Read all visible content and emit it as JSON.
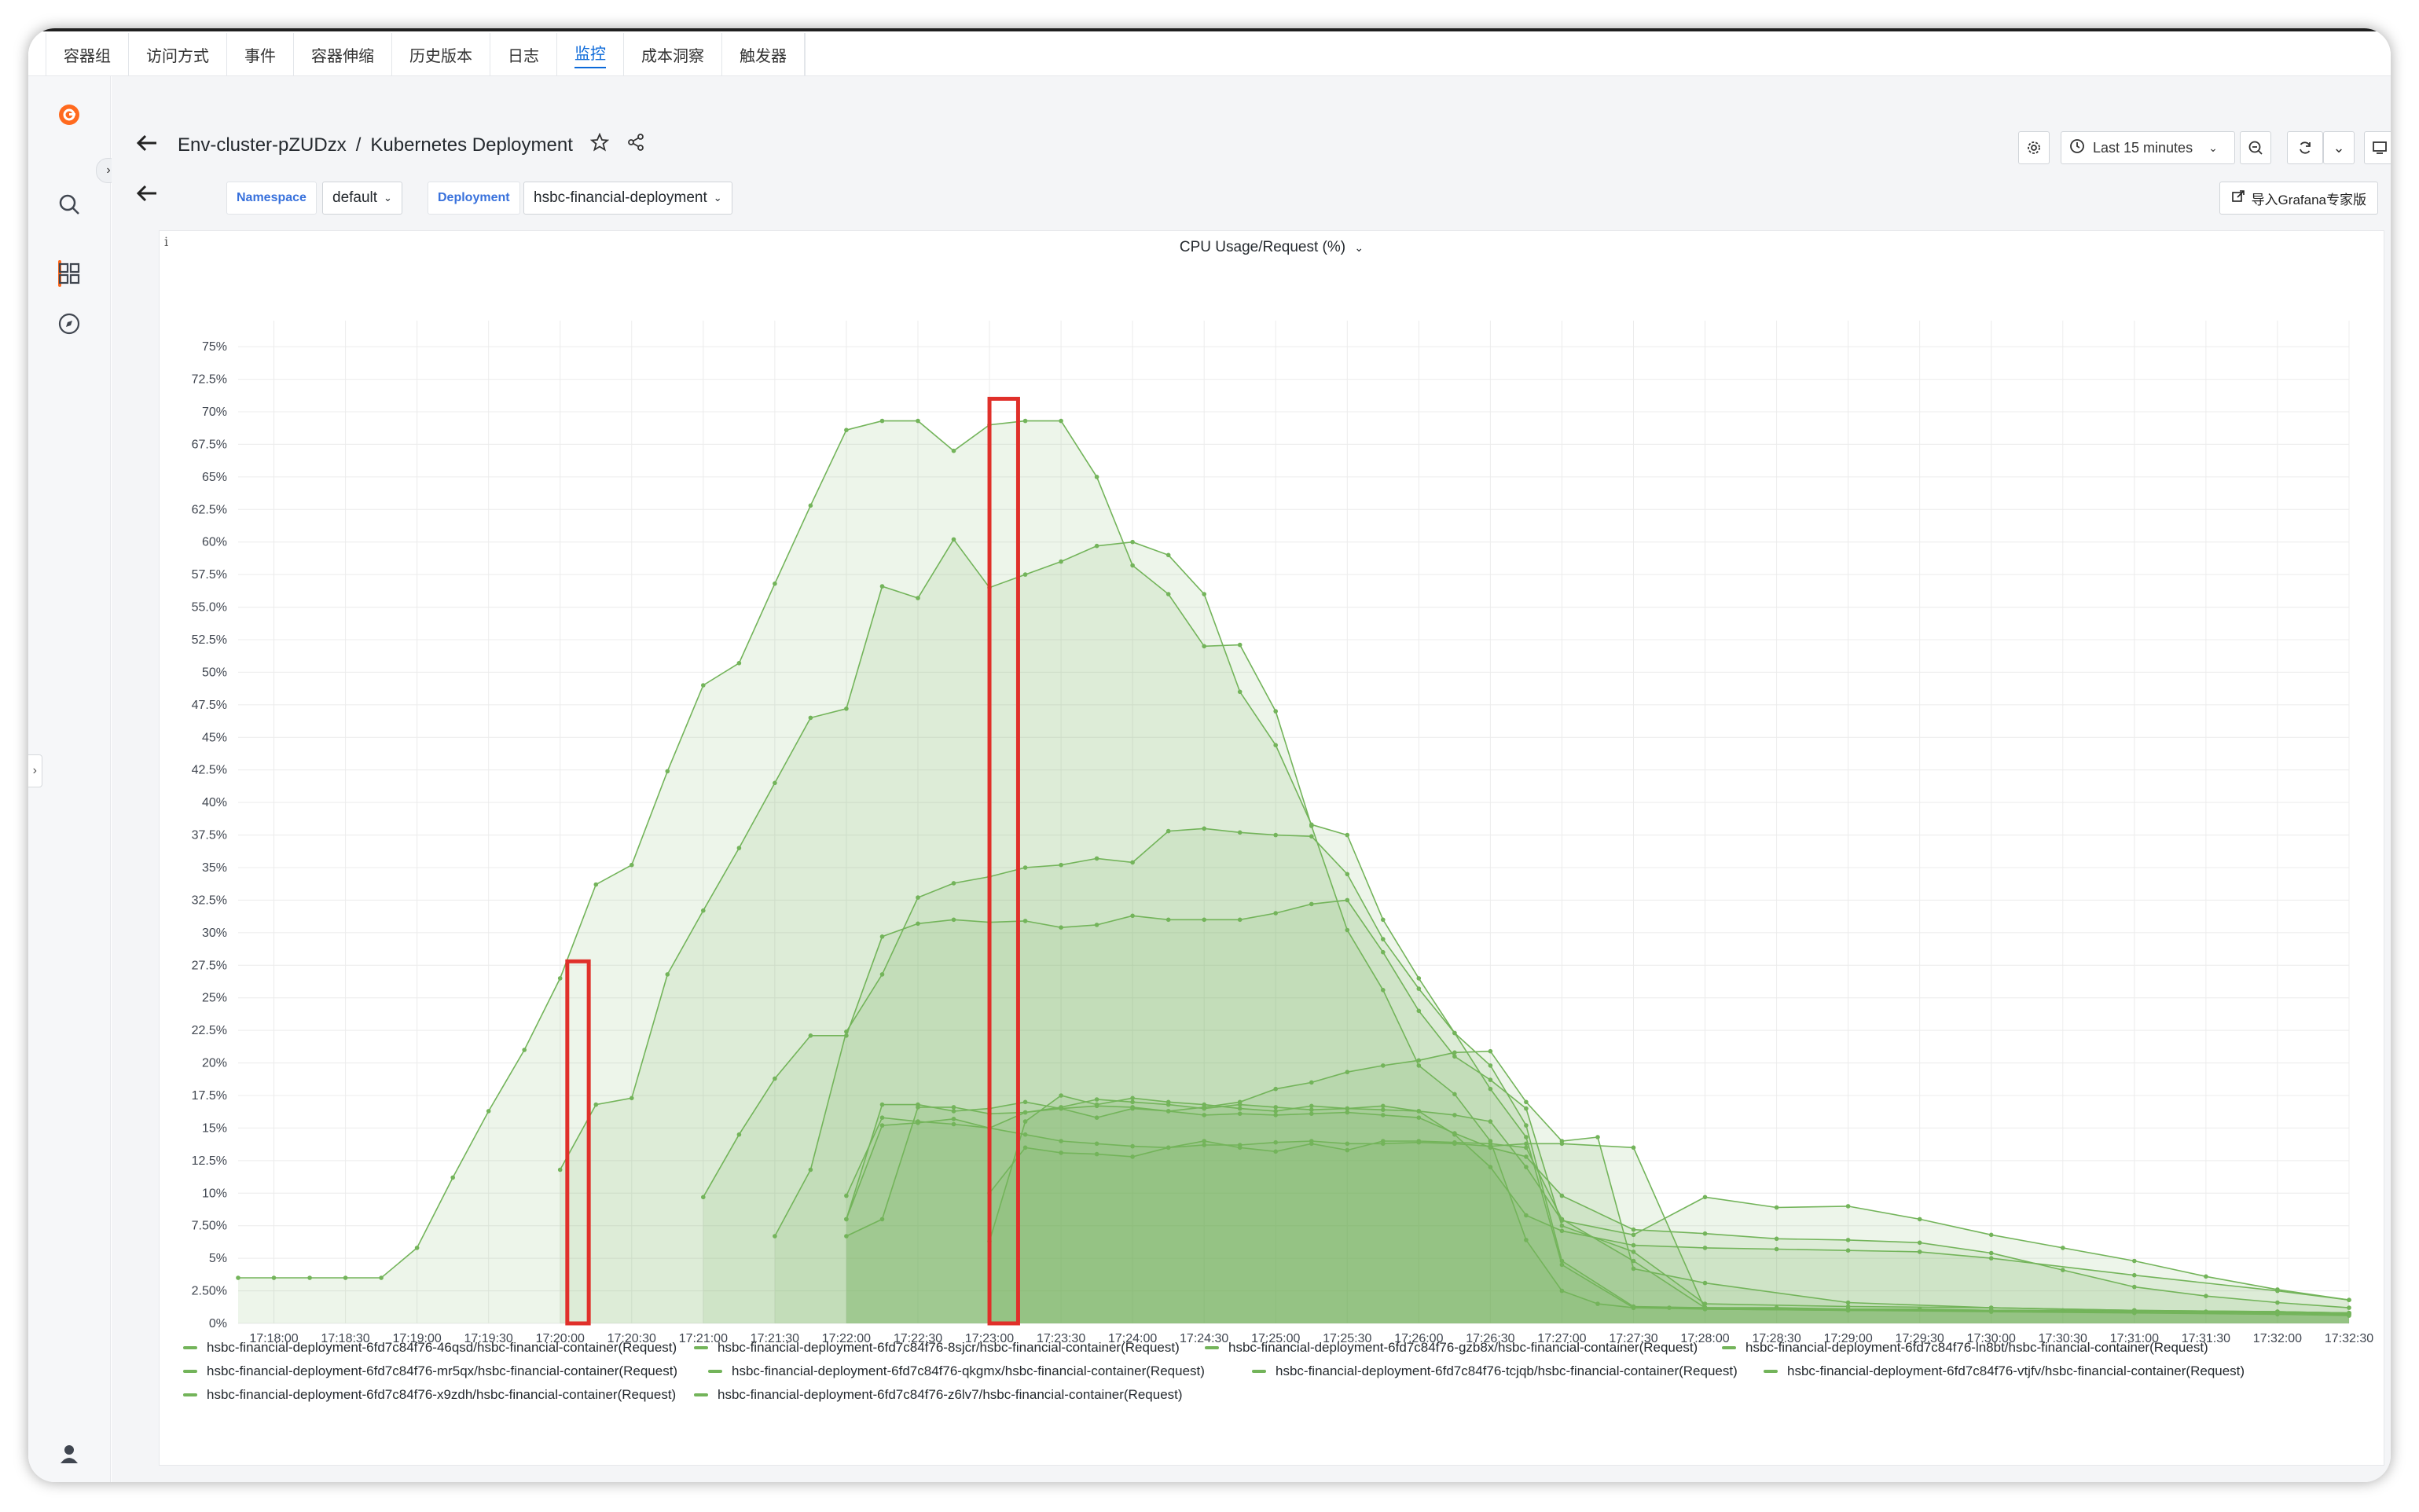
{
  "tabs": [
    {
      "label": "容器组",
      "active": false
    },
    {
      "label": "访问方式",
      "active": false
    },
    {
      "label": "事件",
      "active": false
    },
    {
      "label": "容器伸缩",
      "active": false
    },
    {
      "label": "历史版本",
      "active": false
    },
    {
      "label": "日志",
      "active": false
    },
    {
      "label": "监控",
      "active": true
    },
    {
      "label": "成本洞察",
      "active": false
    },
    {
      "label": "触发器",
      "active": false
    }
  ],
  "breadcrumb": {
    "folder": "Env-cluster-pZUDzx",
    "separator": "/",
    "dashboard": "Kubernetes Deployment"
  },
  "variables": {
    "namespace_label": "Namespace",
    "namespace_value": "default",
    "deployment_label": "Deployment",
    "deployment_value": "hsbc-financial-deployment"
  },
  "toolbar": {
    "time_range": "Last 15 minutes",
    "import_label": "导入Grafana专家版"
  },
  "panel": {
    "title": "CPU Usage/Request (%)",
    "info": "i"
  },
  "colors": {
    "series": "#73b45a",
    "highlight": "#e0302a",
    "accent_tab": "#0b69d9",
    "logo": "#ff6a1f"
  },
  "chart_data": {
    "type": "area",
    "ylim": [
      0,
      77
    ],
    "y_ticks": [
      "0%",
      "2.50%",
      "5%",
      "7.50%",
      "10%",
      "12.5%",
      "15%",
      "17.5%",
      "20%",
      "22.5%",
      "25%",
      "27.5%",
      "30%",
      "32.5%",
      "35%",
      "37.5%",
      "40%",
      "42.5%",
      "45%",
      "47.5%",
      "50%",
      "52.5%",
      "55.0%",
      "57.5%",
      "60%",
      "62.5%",
      "65%",
      "67.5%",
      "70%",
      "72.5%",
      "75%"
    ],
    "x_ticks": [
      "17:18:00",
      "17:18:30",
      "17:19:00",
      "17:19:30",
      "17:20:00",
      "17:20:30",
      "17:21:00",
      "17:21:30",
      "17:22:00",
      "17:22:30",
      "17:23:00",
      "17:23:30",
      "17:24:00",
      "17:24:30",
      "17:25:00",
      "17:25:30",
      "17:26:00",
      "17:26:30",
      "17:27:00",
      "17:27:30",
      "17:28:00",
      "17:28:30",
      "17:29:00",
      "17:29:30",
      "17:30:00",
      "17:30:30",
      "17:31:00",
      "17:31:30",
      "17:32:00",
      "17:32:30"
    ],
    "x_range": [
      "17:17:45",
      "17:32:30"
    ],
    "series": [
      {
        "name": "hsbc-financial-deployment-6fd7c84f76-46qsd/hsbc-financial-container(Request)",
        "x": [
          "17:17:45",
          "17:18:00",
          "17:18:15",
          "17:18:30",
          "17:18:45",
          "17:19:00",
          "17:19:15",
          "17:19:30",
          "17:19:45",
          "17:20:00",
          "17:20:15",
          "17:20:30",
          "17:20:45",
          "17:21:00",
          "17:21:15",
          "17:21:30",
          "17:21:45",
          "17:22:00",
          "17:22:15",
          "17:22:30",
          "17:22:45",
          "17:23:00",
          "17:23:15",
          "17:23:30",
          "17:23:45",
          "17:24:00",
          "17:24:15",
          "17:24:30",
          "17:24:45",
          "17:25:00",
          "17:25:15",
          "17:25:30",
          "17:25:45",
          "17:26:00",
          "17:26:15",
          "17:26:30",
          "17:26:45",
          "17:27:00",
          "17:27:15",
          "17:27:30",
          "17:27:45",
          "17:28:00",
          "17:28:30",
          "17:29:00",
          "17:29:30",
          "17:30:00",
          "17:30:30",
          "17:31:00",
          "17:31:30",
          "17:32:00",
          "17:32:30"
        ],
        "values": [
          3.5,
          3.5,
          3.5,
          3.5,
          3.5,
          5.8,
          11.2,
          16.3,
          21,
          26.5,
          33.7,
          35.2,
          42.4,
          49,
          50.7,
          56.8,
          62.8,
          68.6,
          69.3,
          69.3,
          67,
          69,
          69.3,
          69.3,
          65,
          58.2,
          56,
          52,
          52.1,
          47,
          38.2,
          30.2,
          25.6,
          19.8,
          17.6,
          14,
          6.4,
          2.5,
          1.5,
          1.2,
          1.2,
          1.2,
          1.2,
          1.1,
          1.1,
          1.0,
          1.0,
          1.0,
          0.9,
          0.9,
          0.8
        ]
      },
      {
        "name": "hsbc-financial-deployment-6fd7c84f76-8sjcr/hsbc-financial-container(Request)",
        "x": [
          "17:20:00",
          "17:20:15",
          "17:20:30",
          "17:20:45",
          "17:21:00",
          "17:21:15",
          "17:21:30",
          "17:21:45",
          "17:22:00",
          "17:22:15",
          "17:22:30",
          "17:22:45",
          "17:23:00",
          "17:23:15",
          "17:23:30",
          "17:23:45",
          "17:24:00",
          "17:24:15",
          "17:24:30",
          "17:24:45",
          "17:25:00",
          "17:25:15",
          "17:25:30",
          "17:25:45",
          "17:26:00",
          "17:26:15",
          "17:26:30",
          "17:26:45",
          "17:27:00",
          "17:27:30",
          "17:28:00",
          "17:29:00",
          "17:30:00",
          "17:31:00",
          "17:32:00",
          "17:32:30"
        ],
        "values": [
          11.8,
          16.8,
          17.3,
          26.8,
          31.7,
          36.5,
          41.5,
          46.5,
          47.2,
          56.6,
          55.7,
          60.2,
          56.5,
          57.5,
          58.5,
          59.7,
          60,
          59,
          56,
          48.5,
          44.4,
          38.3,
          37.5,
          31,
          26.5,
          22.3,
          19.8,
          15.2,
          4.8,
          1.3,
          1.2,
          1.1,
          1.0,
          0.9,
          0.8,
          0.7
        ]
      },
      {
        "name": "hsbc-financial-deployment-6fd7c84f76-gzb8x/hsbc-financial-container(Request)",
        "x": [
          "17:21:00",
          "17:21:15",
          "17:21:30",
          "17:21:45",
          "17:22:00",
          "17:22:15",
          "17:22:30",
          "17:22:45",
          "17:23:00",
          "17:23:15",
          "17:23:30",
          "17:23:45",
          "17:24:00",
          "17:24:15",
          "17:24:30",
          "17:24:45",
          "17:25:00",
          "17:25:15",
          "17:25:30",
          "17:25:45",
          "17:26:00",
          "17:26:15",
          "17:26:30",
          "17:26:45",
          "17:27:00",
          "17:27:30",
          "17:28:00",
          "17:29:00",
          "17:30:00",
          "17:31:00",
          "17:32:00",
          "17:32:30"
        ],
        "values": [
          9.7,
          14.5,
          18.8,
          22.1,
          22.1,
          29.7,
          30.7,
          31,
          30.8,
          30.9,
          30.4,
          30.6,
          31.3,
          31,
          31,
          31,
          31.5,
          32.2,
          32.5,
          28.5,
          24,
          20.5,
          18.7,
          16.5,
          7.5,
          5.5,
          1.5,
          1.3,
          1.2,
          1.0,
          0.9,
          0.8
        ]
      },
      {
        "name": "hsbc-financial-deployment-6fd7c84f76-ln8bt/hsbc-financial-container(Request)",
        "x": [
          "17:22:00",
          "17:22:15",
          "17:22:30",
          "17:22:45",
          "17:23:00",
          "17:23:15",
          "17:23:30",
          "17:23:45",
          "17:24:00",
          "17:24:15",
          "17:24:30",
          "17:24:45",
          "17:25:00",
          "17:25:15",
          "17:25:30",
          "17:25:45",
          "17:26:00",
          "17:26:15",
          "17:26:30",
          "17:26:45",
          "17:27:00",
          "17:27:30",
          "17:28:00",
          "17:28:30",
          "17:29:00",
          "17:29:30",
          "17:30:00",
          "17:30:30",
          "17:31:00",
          "17:31:30",
          "17:32:00",
          "17:32:30"
        ],
        "values": [
          6.7,
          8.0,
          16.6,
          16.6,
          16.1,
          16.2,
          16.5,
          16.7,
          16.6,
          16.3,
          16.0,
          16.1,
          16.0,
          16.1,
          16.2,
          16.0,
          15.8,
          14.6,
          13.5,
          12.8,
          9.8,
          7.2,
          6.9,
          6.5,
          6.4,
          6.2,
          5.4,
          4.1,
          2.8,
          2.1,
          1.6,
          1.2
        ]
      },
      {
        "name": "hsbc-financial-deployment-6fd7c84f76-mr5qx/hsbc-financial-container(Request)",
        "x": [
          "17:22:00",
          "17:22:15",
          "17:22:30",
          "17:22:45",
          "17:23:00",
          "17:23:15",
          "17:23:30",
          "17:23:45",
          "17:24:00",
          "17:24:15",
          "17:24:30",
          "17:24:45",
          "17:25:00",
          "17:25:15",
          "17:25:30",
          "17:25:45",
          "17:26:00",
          "17:26:15",
          "17:26:30",
          "17:26:45",
          "17:27:00",
          "17:27:30",
          "17:28:00",
          "17:29:00",
          "17:30:00",
          "17:31:00",
          "17:32:00",
          "17:32:30"
        ],
        "values": [
          9.8,
          15.8,
          15.5,
          15.3,
          15.0,
          14.5,
          14.0,
          13.8,
          13.6,
          13.5,
          13.7,
          13.7,
          13.9,
          14.0,
          13.8,
          13.8,
          13.9,
          13.8,
          13.6,
          13.8,
          13.8,
          13.5,
          1.1,
          1.0,
          1.0,
          0.9,
          0.8,
          0.7
        ]
      },
      {
        "name": "hsbc-financial-deployment-6fd7c84f76-qkgmx/hsbc-financial-container(Request)",
        "x": [
          "17:23:00",
          "17:23:15",
          "17:23:30",
          "17:23:45",
          "17:24:00",
          "17:24:15",
          "17:24:30",
          "17:24:45",
          "17:25:00",
          "17:25:15",
          "17:25:30",
          "17:25:45",
          "17:26:00",
          "17:26:15",
          "17:26:30",
          "17:26:45",
          "17:27:00",
          "17:27:30",
          "17:28:00",
          "17:28:30",
          "17:29:00",
          "17:29:30",
          "17:30:00",
          "17:30:30",
          "17:31:00",
          "17:31:30",
          "17:32:00",
          "17:32:30"
        ],
        "values": [
          6.3,
          15.5,
          17.5,
          16.8,
          17.3,
          17.0,
          16.8,
          16.5,
          16.3,
          16.7,
          16.5,
          16.4,
          16.3,
          16.0,
          15.5,
          12.0,
          7.9,
          6.8,
          9.7,
          8.9,
          9.0,
          8.0,
          6.8,
          5.8,
          4.8,
          3.6,
          2.6,
          1.8
        ]
      },
      {
        "name": "hsbc-financial-deployment-6fd7c84f76-tcjqb/hsbc-financial-container(Request)",
        "x": [
          "17:21:30",
          "17:21:45",
          "17:22:00",
          "17:22:15",
          "17:22:30",
          "17:22:45",
          "17:23:00",
          "17:23:15",
          "17:23:30",
          "17:23:45",
          "17:24:00",
          "17:24:15",
          "17:24:30",
          "17:24:45",
          "17:25:00",
          "17:25:15",
          "17:25:30",
          "17:25:45",
          "17:26:00",
          "17:26:15",
          "17:26:30",
          "17:26:45",
          "17:27:00",
          "17:27:30",
          "17:28:00",
          "17:29:00",
          "17:30:00",
          "17:31:00",
          "17:32:00",
          "17:32:30"
        ],
        "values": [
          6.7,
          11.8,
          22.4,
          26.8,
          32.7,
          33.8,
          34.3,
          35.0,
          35.2,
          35.7,
          35.4,
          37.8,
          38.0,
          37.7,
          37.5,
          37.4,
          34.5,
          29.5,
          25.7,
          22.3,
          18.0,
          14.3,
          4.5,
          1.2,
          1.1,
          1.0,
          0.9,
          0.8,
          0.7,
          0.6
        ]
      },
      {
        "name": "hsbc-financial-deployment-6fd7c84f76-vtjfv/hsbc-financial-container(Request)",
        "x": [
          "17:22:00",
          "17:22:15",
          "17:22:30",
          "17:22:45",
          "17:23:00",
          "17:23:15",
          "17:23:30",
          "17:23:45",
          "17:24:00",
          "17:24:15",
          "17:24:30",
          "17:24:45",
          "17:25:00",
          "17:25:15",
          "17:25:30",
          "17:25:45",
          "17:26:00",
          "17:26:15",
          "17:26:30",
          "17:26:45",
          "17:27:00",
          "17:27:15",
          "17:27:30",
          "17:28:00",
          "17:29:00",
          "17:30:00",
          "17:31:00",
          "17:32:00",
          "17:32:30"
        ],
        "values": [
          8.0,
          16.8,
          16.8,
          16.3,
          16.5,
          17.0,
          16.5,
          15.8,
          16.5,
          16.3,
          16.6,
          17.0,
          18.0,
          18.5,
          19.3,
          19.8,
          20.2,
          20.8,
          20.9,
          17.0,
          14.0,
          14.3,
          4.2,
          3.1,
          1.6,
          1.2,
          1.0,
          0.9,
          0.8
        ]
      },
      {
        "name": "hsbc-financial-deployment-6fd7c84f76-x9zdh/hsbc-financial-container(Request)",
        "x": [
          "17:23:00",
          "17:23:15",
          "17:23:30",
          "17:23:45",
          "17:24:00",
          "17:24:15",
          "17:24:30",
          "17:24:45",
          "17:25:00",
          "17:25:15",
          "17:25:30",
          "17:25:45",
          "17:26:00",
          "17:26:15",
          "17:26:30",
          "17:26:45",
          "17:27:00",
          "17:27:30",
          "17:28:00",
          "17:29:00",
          "17:30:00",
          "17:31:00",
          "17:32:00",
          "17:32:30"
        ],
        "values": [
          10.0,
          13.5,
          13.1,
          13.0,
          12.8,
          13.5,
          14.0,
          13.5,
          13.2,
          13.8,
          13.3,
          14.0,
          14.0,
          13.9,
          13.8,
          13.5,
          8.0,
          4.8,
          1.2,
          1.1,
          1.0,
          0.9,
          0.8,
          0.7
        ]
      },
      {
        "name": "hsbc-financial-deployment-6fd7c84f76-z6lv7/hsbc-financial-container(Request)",
        "x": [
          "17:22:00",
          "17:22:15",
          "17:22:30",
          "17:22:45",
          "17:23:00",
          "17:23:15",
          "17:23:30",
          "17:23:45",
          "17:24:00",
          "17:24:15",
          "17:24:30",
          "17:24:45",
          "17:25:00",
          "17:25:15",
          "17:25:30",
          "17:25:45",
          "17:26:00",
          "17:26:15",
          "17:26:30",
          "17:26:45",
          "17:27:00",
          "17:27:30",
          "17:28:00",
          "17:28:30",
          "17:29:00",
          "17:29:30",
          "17:30:00",
          "17:31:00",
          "17:32:00",
          "17:32:30"
        ],
        "values": [
          8.0,
          15.2,
          15.4,
          15.7,
          15.0,
          16.2,
          16.6,
          17.2,
          17.0,
          16.8,
          16.5,
          16.8,
          16.6,
          16.4,
          16.5,
          16.7,
          16.3,
          14.5,
          12.0,
          8.3,
          7.1,
          6.0,
          5.8,
          5.7,
          5.6,
          5.5,
          5.0,
          3.7,
          2.5,
          1.8
        ]
      }
    ],
    "highlights": [
      {
        "x0": "17:20:03",
        "x1": "17:20:12",
        "y0": 0,
        "y1": 27.8
      },
      {
        "x0": "17:23:00",
        "x1": "17:23:12",
        "y0": 0,
        "y1": 71
      }
    ],
    "legend_placement": "bottom",
    "grid": true
  }
}
